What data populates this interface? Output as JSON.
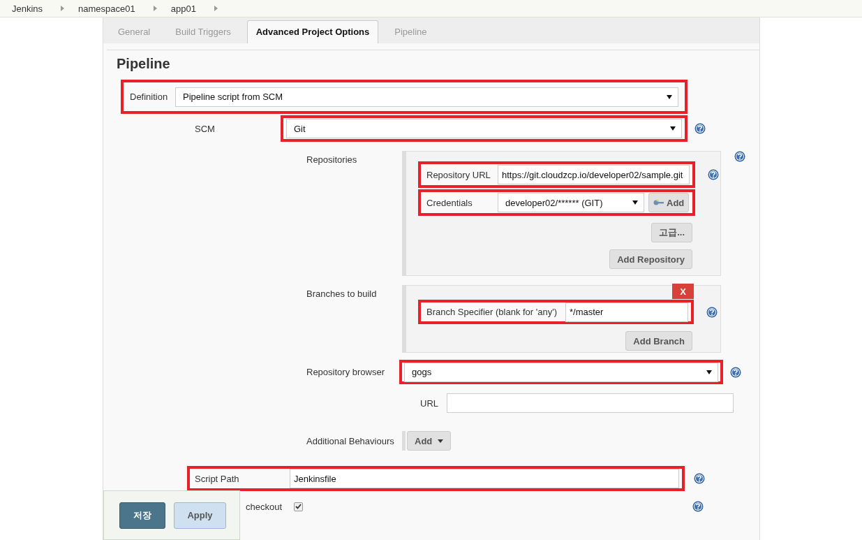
{
  "breadcrumbs": [
    {
      "label": "Jenkins"
    },
    {
      "label": "namespace01"
    },
    {
      "label": "app01"
    }
  ],
  "tabs": [
    {
      "label": "General",
      "selected": false
    },
    {
      "label": "Build Triggers",
      "selected": false
    },
    {
      "label": "Advanced Project Options",
      "selected": true
    },
    {
      "label": "Pipeline",
      "selected": false
    }
  ],
  "section_title": "Pipeline",
  "definition": {
    "label": "Definition",
    "value": "Pipeline script from SCM"
  },
  "scm": {
    "label": "SCM",
    "value": "Git"
  },
  "repositories": {
    "label": "Repositories",
    "url_label": "Repository URL",
    "url": "https://git.cloudzcp.io/developer02/sample.git",
    "credentials_label": "Credentials",
    "credentials": "developer02/****** (GIT)",
    "add_credentials": "Add",
    "advanced": "고급...",
    "add_repository": "Add Repository"
  },
  "branches": {
    "label": "Branches to build",
    "delete": "X",
    "specifier_label": "Branch Specifier (blank for 'any')",
    "specifier": "*/master",
    "add_branch": "Add Branch"
  },
  "repository_browser": {
    "label": "Repository browser",
    "value": "gogs",
    "url_label": "URL"
  },
  "additional_behaviours": {
    "label": "Additional Behaviours",
    "add": "Add"
  },
  "script_path": {
    "label": "Script Path",
    "value": "Jenkinsfile"
  },
  "lightweight_checkout": {
    "label": "checkout",
    "checked": true
  },
  "buttons": {
    "save": "저장",
    "apply": "Apply"
  }
}
